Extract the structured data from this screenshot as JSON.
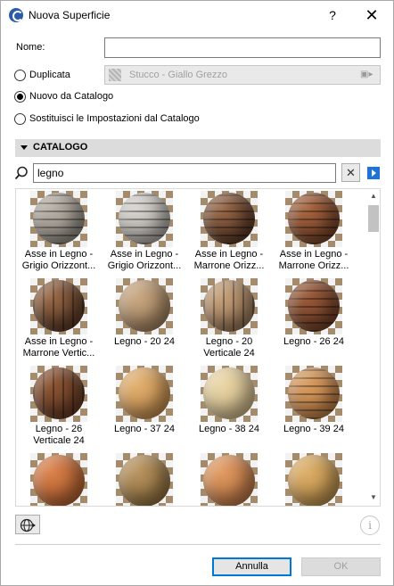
{
  "window": {
    "title": "Nuova Superficie",
    "help_label": "?",
    "close_label": "✕"
  },
  "form": {
    "nome_label": "Nome:",
    "nome_value": "",
    "radio_duplicata": "Duplicata",
    "radio_nuovo": "Nuovo da Catalogo",
    "radio_sostituisci": "Sostituisci le Impostazioni dal Catalogo",
    "selected_option": "Nuovo da Catalogo",
    "duplicata_value": "Stucco - Giallo Grezzo"
  },
  "catalog": {
    "header": "CATALOGO",
    "search_value": "legno",
    "clear_label": "✕",
    "scroll_up": "▲",
    "scroll_down": "▼",
    "items": [
      {
        "label": "Asse in Legno - Grigio Orizzont...",
        "colors": [
          "#b7b0a6",
          "#8e877d"
        ],
        "stripes": "h"
      },
      {
        "label": "Asse in Legno - Grigio Orizzont...",
        "colors": [
          "#d7d4cf",
          "#a8a49e"
        ],
        "stripes": "h"
      },
      {
        "label": "Asse in Legno - Marrone Orizz...",
        "colors": [
          "#9a6a4a",
          "#4a2a1a"
        ],
        "stripes": "h"
      },
      {
        "label": "Asse in Legno - Marrone Orizz...",
        "colors": [
          "#a8653f",
          "#6a3a22"
        ],
        "stripes": "h"
      },
      {
        "label": "Asse in Legno - Marrone Vertic...",
        "colors": [
          "#9a6a48",
          "#4a2c1c"
        ],
        "stripes": "v"
      },
      {
        "label": "Legno - 20 24",
        "colors": [
          "#c9a882",
          "#9a7a58"
        ],
        "stripes": "none"
      },
      {
        "label": "Legno - 20 Verticale 24",
        "colors": [
          "#c6a07a",
          "#8e6e50"
        ],
        "stripes": "v"
      },
      {
        "label": "Legno - 26 24",
        "colors": [
          "#9a5a38",
          "#6a3a24"
        ],
        "stripes": "h"
      },
      {
        "label": "Legno - 26 Verticale 24",
        "colors": [
          "#8e5634",
          "#5a3220"
        ],
        "stripes": "v"
      },
      {
        "label": "Legno - 37 24",
        "colors": [
          "#e2b070",
          "#c08848"
        ],
        "stripes": "none"
      },
      {
        "label": "Legno - 38 24",
        "colors": [
          "#ead6a6",
          "#cab486"
        ],
        "stripes": "none"
      },
      {
        "label": "Legno - 39 24",
        "colors": [
          "#d89c60",
          "#b87840"
        ],
        "stripes": "h"
      },
      {
        "label": "",
        "colors": [
          "#d8804a",
          "#b05a2a"
        ],
        "stripes": "none"
      },
      {
        "label": "",
        "colors": [
          "#b89460",
          "#8a6a38"
        ],
        "stripes": "none"
      },
      {
        "label": "",
        "colors": [
          "#e09a60",
          "#b87040"
        ],
        "stripes": "none"
      },
      {
        "label": "",
        "colors": [
          "#dcae68",
          "#b88a44"
        ],
        "stripes": "none"
      }
    ]
  },
  "footer": {
    "globe_icon": "globe-icon",
    "info_label": "i",
    "cancel_label": "Annulla",
    "ok_label": "OK"
  }
}
